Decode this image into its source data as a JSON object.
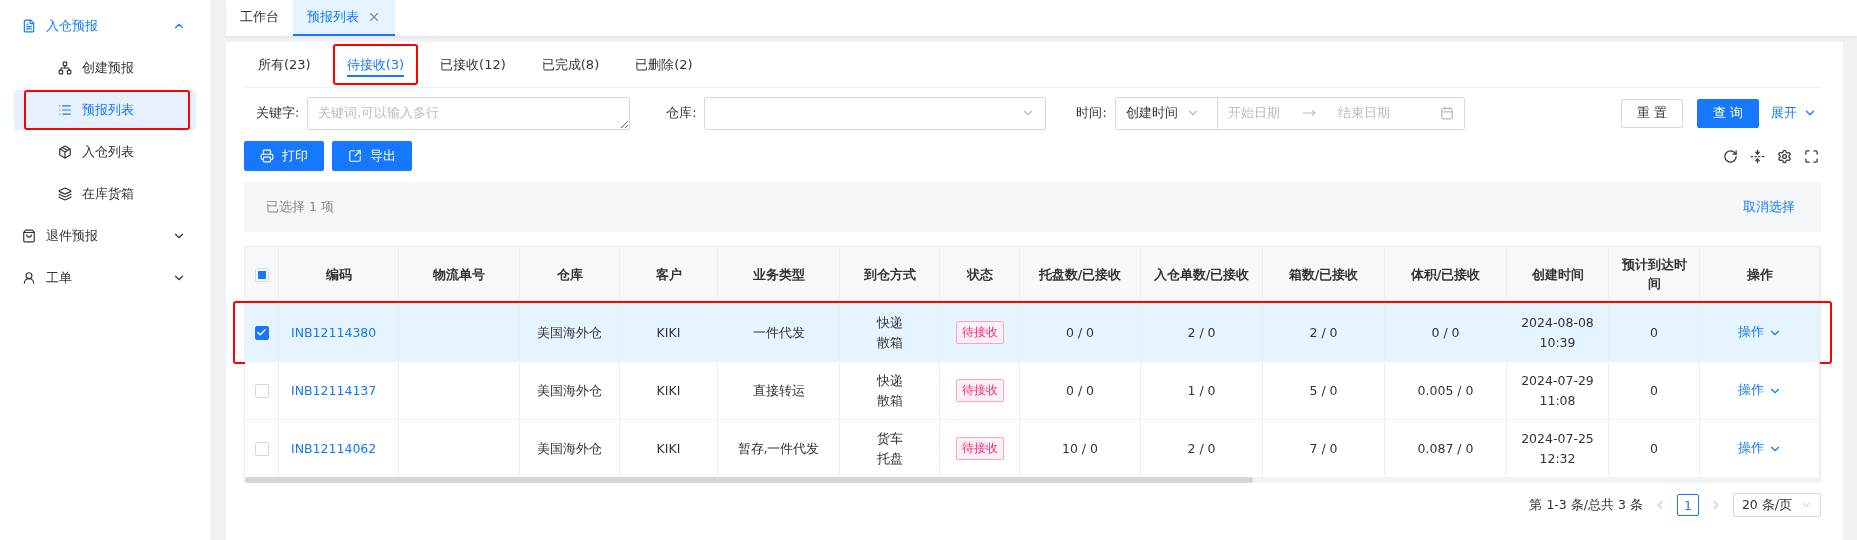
{
  "sidebar": {
    "items": [
      {
        "label": "入仓预报",
        "expanded": true,
        "children": [
          {
            "label": "创建预报",
            "selected": false,
            "highlighted": false
          },
          {
            "label": "预报列表",
            "selected": true,
            "highlighted": true
          },
          {
            "label": "入仓列表",
            "selected": false,
            "highlighted": false
          },
          {
            "label": "在库货箱",
            "selected": false,
            "highlighted": false
          }
        ]
      },
      {
        "label": "退件预报",
        "expanded": false
      },
      {
        "label": "工单",
        "expanded": false
      }
    ]
  },
  "page_tabs": [
    {
      "label": "工作台",
      "selected": false,
      "closable": false
    },
    {
      "label": "预报列表",
      "selected": true,
      "closable": true
    }
  ],
  "status_tabs": [
    {
      "label": "所有(23)",
      "selected": false,
      "highlighted": false
    },
    {
      "label": "待接收(3)",
      "selected": true,
      "highlighted": true
    },
    {
      "label": "已接收(12)",
      "selected": false,
      "highlighted": false
    },
    {
      "label": "已完成(8)",
      "selected": false,
      "highlighted": false
    },
    {
      "label": "已删除(2)",
      "selected": false,
      "highlighted": false
    }
  ],
  "filters": {
    "keyword_label": "关键字:",
    "keyword_placeholder": "关键词,可以输入多行",
    "warehouse_label": "仓库:",
    "time_label": "时间:",
    "time_type": "创建时间",
    "start_placeholder": "开始日期",
    "end_placeholder": "结束日期",
    "reset": "重 置",
    "search": "查 询",
    "expand": "展开"
  },
  "actions": [
    {
      "label": "打印"
    },
    {
      "label": "导出"
    }
  ],
  "selection": {
    "text": "已选择 1 项",
    "clear": "取消选择"
  },
  "table": {
    "indeterminate": true,
    "columns": [
      "编码",
      "物流单号",
      "仓库",
      "客户",
      "业务类型",
      "到仓方式",
      "状态",
      "托盘数/已接收",
      "入仓单数/已接收",
      "箱数/已接收",
      "体积/已接收",
      "创建时间",
      "预计到达时间",
      "操作"
    ],
    "rows": [
      {
        "selected": true,
        "highlighted": true,
        "code": "INB12114380",
        "tracking": "",
        "warehouse": "美国海外仓",
        "customer": "KIKI",
        "business": "一件代发",
        "method": [
          "快递",
          "散箱"
        ],
        "status": "待接收",
        "pallets": "0 / 0",
        "orders": "2 / 0",
        "boxes": "2 / 0",
        "volume": "0 / 0",
        "created": [
          "2024-08-08",
          "10:39"
        ],
        "eta": "0",
        "action": "操作"
      },
      {
        "selected": false,
        "highlighted": false,
        "code": "INB12114137",
        "tracking": "",
        "warehouse": "美国海外仓",
        "customer": "KIKI",
        "business": "直接转运",
        "method": [
          "快递",
          "散箱"
        ],
        "status": "待接收",
        "pallets": "0 / 0",
        "orders": "1 / 0",
        "boxes": "5 / 0",
        "volume": "0.005 / 0",
        "created": [
          "2024-07-29",
          "11:08"
        ],
        "eta": "0",
        "action": "操作"
      },
      {
        "selected": false,
        "highlighted": false,
        "code": "INB12114062",
        "tracking": "",
        "warehouse": "美国海外仓",
        "customer": "KIKI",
        "business": "暂存,一件代发",
        "method": [
          "货车",
          "托盘"
        ],
        "status": "待接收",
        "pallets": "10 / 0",
        "orders": "2 / 0",
        "boxes": "7 / 0",
        "volume": "0.087 / 0",
        "created": [
          "2024-07-25",
          "12:32"
        ],
        "eta": "0",
        "action": "操作"
      }
    ]
  },
  "pagination": {
    "summary": "第 1-3 条/总共 3 条",
    "pages": [
      {
        "label": "1",
        "selected": true
      }
    ],
    "page_size": "20 条/页"
  }
}
